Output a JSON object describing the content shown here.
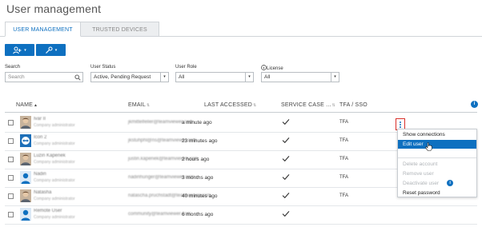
{
  "page": {
    "title": "User management"
  },
  "tabs": [
    {
      "label": "USER MANAGEMENT",
      "active": true
    },
    {
      "label": "TRUSTED DEVICES",
      "active": false
    }
  ],
  "toolbar": {
    "add_user_icon": "add-user-icon",
    "tools_icon": "wrench-icon",
    "caret": "▾"
  },
  "filters": {
    "search": {
      "label": "Search",
      "placeholder": "Search"
    },
    "status": {
      "label": "User Status",
      "value": "Active, Pending Request"
    },
    "role": {
      "label": "User Role",
      "value": "All"
    },
    "license": {
      "label": "License",
      "value": "All"
    }
  },
  "table": {
    "columns": [
      {
        "label": "NAME"
      },
      {
        "label": "EMAIL"
      },
      {
        "label": "LAST ACCESSED"
      },
      {
        "label": "SERVICE CASE ..."
      },
      {
        "label": "TFA / SSO"
      }
    ],
    "rows": [
      {
        "name": "Ivar II",
        "role": "Company administrator",
        "email": "jkmittelfeller@teamviewer.com",
        "last_accessed": "a minute ago",
        "service_case": true,
        "tfa": "TFA",
        "avatar": "photo"
      },
      {
        "name": "Icon 2",
        "role": "Company administrator",
        "email": "jkstuhphl@ns@teamviewer.com",
        "last_accessed": "23 minutes ago",
        "service_case": true,
        "tfa": "TFA",
        "avatar": "logo"
      },
      {
        "name": "Luzin Kapenek",
        "role": "Company administrator",
        "email": "justin.kapenek@teamviewer.com",
        "last_accessed": "2 hours ago",
        "service_case": true,
        "tfa": "TFA",
        "avatar": "photo"
      },
      {
        "name": "Nadin",
        "role": "Company administrator",
        "email": "nadinhunger@teamviewer.com",
        "last_accessed": "3 months ago",
        "service_case": true,
        "tfa": "TFA",
        "avatar": "user"
      },
      {
        "name": "Natasha",
        "role": "Company administrator",
        "email": "natascha.pruchstadt@teamviewer.com",
        "last_accessed": "40 minutes ago",
        "service_case": true,
        "tfa": "TFA",
        "avatar": "photo"
      },
      {
        "name": "Remote User",
        "role": "Company administrator",
        "email": "community@teamviewer.com",
        "last_accessed": "6 months ago",
        "service_case": true,
        "tfa": "",
        "avatar": "user"
      }
    ]
  },
  "context_menu": {
    "items": [
      {
        "label": "Show connections",
        "state": "normal"
      },
      {
        "label": "Edit user",
        "state": "highlighted"
      },
      {
        "label": "Delete account",
        "state": "disabled"
      },
      {
        "label": "Remove user",
        "state": "disabled"
      },
      {
        "label": "Deactivate user",
        "state": "disabled",
        "info": "i"
      },
      {
        "label": "Reset password",
        "state": "normal"
      }
    ]
  },
  "info_glyph": "i",
  "colors": {
    "accent": "#0e70c0",
    "kebab_highlight": "#d9302b"
  }
}
